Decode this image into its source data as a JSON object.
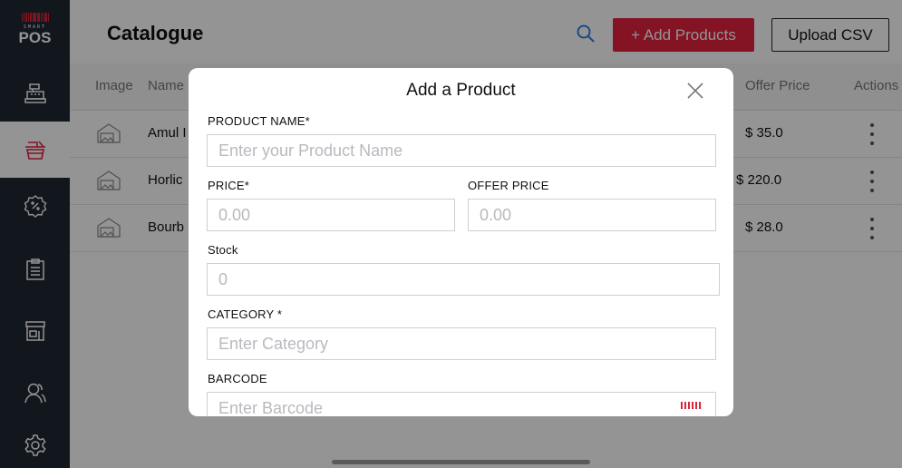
{
  "app": {
    "logo_top": "SMART",
    "logo_bottom": "POS"
  },
  "colors": {
    "sidebar": "#1f2633",
    "accent": "#e3213f",
    "barcode": "#d9243b"
  },
  "sidebar": {
    "items": [
      {
        "icon": "cash-register-icon",
        "active": false
      },
      {
        "icon": "basket-icon",
        "active": true
      },
      {
        "icon": "discount-badge-icon",
        "active": false
      },
      {
        "icon": "clipboard-icon",
        "active": false
      },
      {
        "icon": "store-icon",
        "active": false
      },
      {
        "icon": "users-icon",
        "active": false
      },
      {
        "icon": "settings-gear-icon",
        "active": false
      }
    ]
  },
  "header": {
    "title": "Catalogue",
    "add_button": "+ Add Products",
    "upload_button": "Upload CSV"
  },
  "table": {
    "columns": [
      "Image",
      "Name",
      "Offer Price",
      "Actions"
    ],
    "rows": [
      {
        "name": "Amul I",
        "offer_price": "$ 35.0"
      },
      {
        "name": "Horlic",
        "offer_price": "$ 220.0"
      },
      {
        "name": "Bourb",
        "offer_price": "$ 28.0"
      }
    ]
  },
  "modal": {
    "title": "Add a Product",
    "product_name": {
      "label": "PRODUCT NAME*",
      "placeholder": "Enter your Product Name"
    },
    "price": {
      "label": "PRICE*",
      "placeholder": "0.00"
    },
    "offer_price": {
      "label": "OFFER PRICE",
      "placeholder": "0.00"
    },
    "stock": {
      "label": "Stock",
      "placeholder": "0"
    },
    "category": {
      "label": "CATEGORY *",
      "placeholder": "Enter Category"
    },
    "barcode": {
      "label": "BARCODE",
      "placeholder": "Enter Barcode"
    }
  }
}
